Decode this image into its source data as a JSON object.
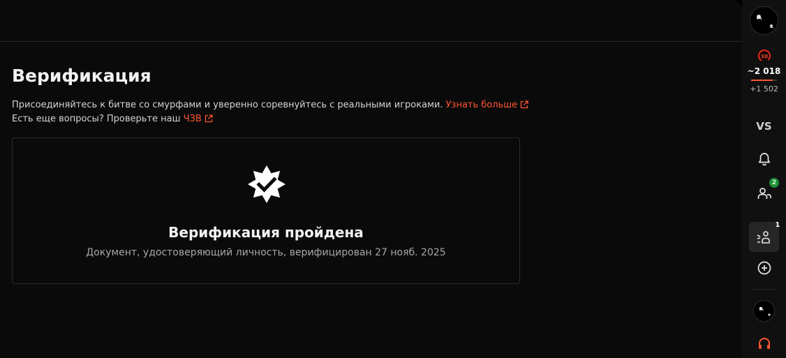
{
  "page": {
    "title": "Верификация",
    "description_text": "Присоединяйтесь к битве со смурфами и уверенно соревнуйтесь с реальными игроками.",
    "learn_more_label": "Узнать больше",
    "faq_text": "Есть еще вопросы? Проверьте наш",
    "faq_link_label": "ЧЗВ"
  },
  "card": {
    "title": "Верификация пройдена",
    "subtitle": "Документ, удостоверяющий личность, верифицирован 27 нояб. 2025",
    "icon": "verified-badge-icon"
  },
  "sidebar": {
    "level": "10",
    "elo": "2 018",
    "elo_diff": "+1 502",
    "elo_progress": 0.85,
    "vs_label": "VS",
    "friends_badge": "2",
    "party_badge": "1",
    "icons": [
      "avatar",
      "level-icon",
      "bell-icon",
      "friends-icon",
      "party-icon",
      "plus-circle-icon",
      "headset-icon"
    ]
  },
  "colors": {
    "accent": "#ff5533",
    "background": "#0a0a0a",
    "sidebar": "#101010",
    "badge_green": "#1f8f3a"
  }
}
